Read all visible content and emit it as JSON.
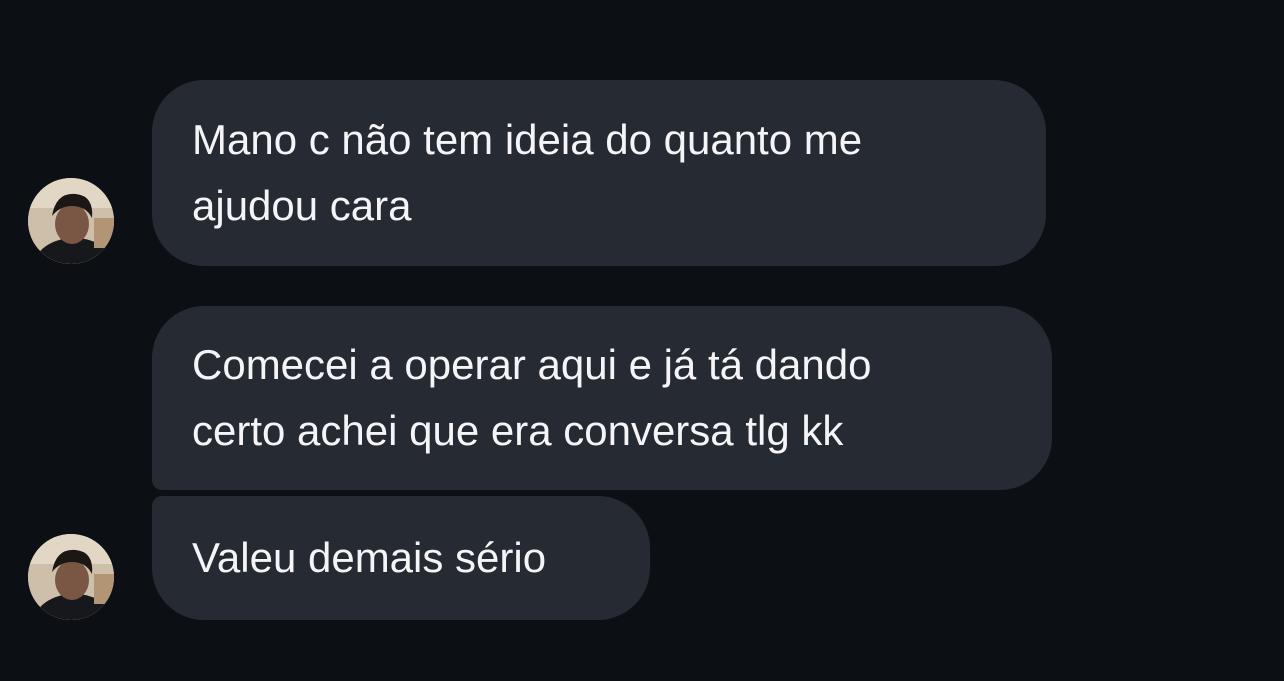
{
  "chat": {
    "messages": [
      {
        "text": "Mano c não tem ideia do quanto me\najudou cara"
      },
      {
        "text": "Comecei a operar aqui e já tá dando\ncerto achei que era conversa tlg kk"
      },
      {
        "text": "Valeu demais sério"
      }
    ]
  },
  "colors": {
    "background": "#0c1014",
    "bubble": "#262a33",
    "text": "#f5f5f7"
  },
  "icons": {
    "avatar": "user-avatar-photo"
  }
}
